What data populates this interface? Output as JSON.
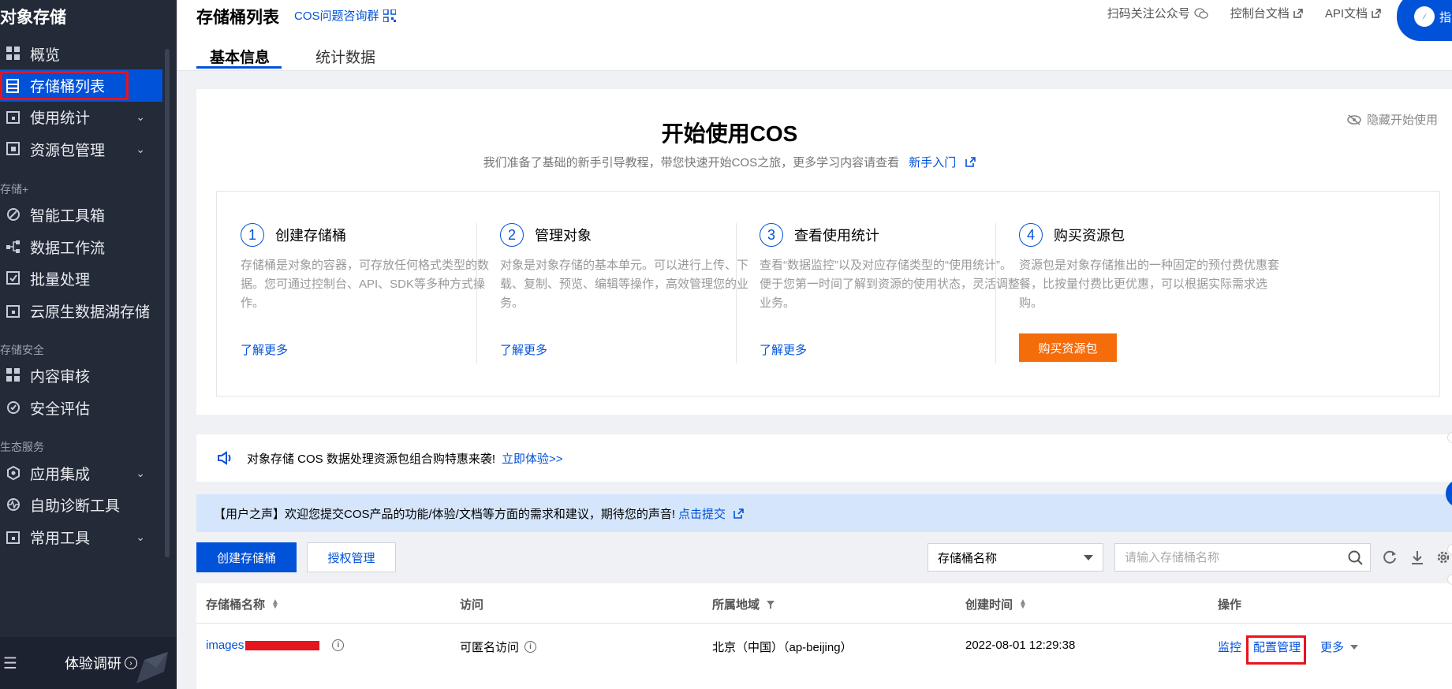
{
  "sidebar": {
    "title": "对象存储",
    "items": [
      {
        "label": "概览"
      },
      {
        "label": "存储桶列表"
      },
      {
        "label": "使用统计"
      },
      {
        "label": "资源包管理"
      },
      {
        "label": "智能工具箱"
      },
      {
        "label": "数据工作流"
      },
      {
        "label": "批量处理"
      },
      {
        "label": "云原生数据湖存储"
      },
      {
        "label": "内容审核"
      },
      {
        "label": "安全评估"
      },
      {
        "label": "应用集成"
      },
      {
        "label": "自助诊断工具"
      },
      {
        "label": "常用工具"
      }
    ],
    "sections": [
      "存储+",
      "存储安全",
      "生态服务"
    ],
    "survey_label": "体验调研"
  },
  "header": {
    "title": "存储桶列表",
    "qq_group": "COS问题咨询群",
    "links": [
      "扫码关注公众号",
      "控制台文档",
      "API文档"
    ],
    "guide_label": "指",
    "tabs": [
      "基本信息",
      "统计数据"
    ]
  },
  "getting_started": {
    "title": "开始使用COS",
    "subtitle": "我们准备了基础的新手引导教程，带您快速开始COS之旅，更多学习内容请查看",
    "newbie_link": "新手入门",
    "hide_label": "隐藏开始使用",
    "steps": [
      {
        "num": "1",
        "title": "创建存储桶",
        "desc": "存储桶是对象的容器，可存放任何格式类型的数据。您可通过控制台、API、SDK等多种方式操作。",
        "link": "了解更多"
      },
      {
        "num": "2",
        "title": "管理对象",
        "desc": "对象是对象存储的基本单元。可以进行上传、下载、复制、预览、编辑等操作，高效管理您的业务。",
        "link": "了解更多"
      },
      {
        "num": "3",
        "title": "查看使用统计",
        "desc": "查看“数据监控”以及对应存储类型的“使用统计”。便于您第一时间了解到资源的使用状态，灵活调整业务。",
        "link": "了解更多"
      },
      {
        "num": "4",
        "title": "购买资源包",
        "desc": "资源包是对象存储推出的一种固定的预付费优惠套餐，比按量付费比更优惠，可以根据实际需求选购。",
        "button": "购买资源包"
      }
    ]
  },
  "notice": {
    "text": "对象存储 COS 数据处理资源包组合购特惠来袭!",
    "link": "立即体验>>"
  },
  "voice": {
    "text": "【用户之声】欢迎您提交COS产品的功能/体验/文档等方面的需求和建议，期待您的声音!",
    "link": "点击提交"
  },
  "toolbar": {
    "create_label": "创建存储桶",
    "auth_label": "授权管理",
    "filter_value": "存储桶名称",
    "search_placeholder": "请输入存储桶名称"
  },
  "table": {
    "columns": [
      "存储桶名称",
      "访问",
      "所属地域",
      "创建时间",
      "操作"
    ],
    "rows": [
      {
        "name": "images",
        "access": "可匿名访问",
        "region": "北京（中国）（ap-beijing）",
        "created": "2022-08-01 12:29:38",
        "actions": [
          "监控",
          "配置管理",
          "更多"
        ]
      }
    ]
  },
  "colors": {
    "sidebar_bg": "#232a38",
    "accent": "#0052d9",
    "buy_button": "#f56c0b",
    "highlight_box": "#e8141c"
  }
}
